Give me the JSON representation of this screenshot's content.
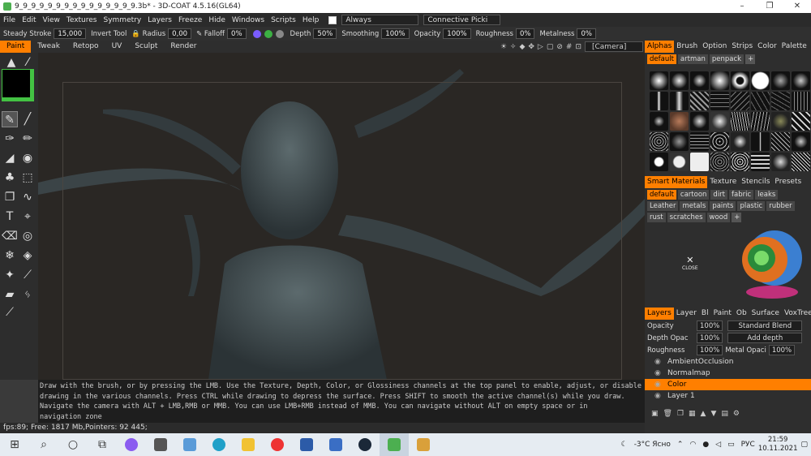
{
  "title": "9_9_9_9_9_9_9_9_9_9_9_9_9_9_9.3b* - 3D-COAT 4.5.16(GL64)",
  "window_controls": {
    "minimize": "–",
    "maximize": "❐",
    "close": "✕"
  },
  "menu": [
    "File",
    "Edit",
    "View",
    "Textures",
    "Symmetry",
    "Layers",
    "Freeze",
    "Hide",
    "Windows",
    "Scripts",
    "Help"
  ],
  "menu_always": "Always",
  "menu_connective": "Connective Picki",
  "toolbar": {
    "steady_label": "Steady",
    "stroke_label": "Stroke",
    "stroke_value": "15,000",
    "invert_label": "Invert",
    "tool_label": "Tool",
    "radius_label": "Radius",
    "radius_value": "0,00",
    "falloff_label": "Falloff",
    "falloff_value": "0%",
    "depth_label": "Depth",
    "depth_value": "50%",
    "smoothing_label": "Smoothing",
    "smoothing_value": "100%",
    "opacity_label": "Opacity",
    "opacity_value": "100%",
    "roughness_label": "Roughness",
    "roughness_value": "0%",
    "metalness_label": "Metalness",
    "metalness_value": "0%"
  },
  "room_tabs": [
    "Paint",
    "Tweak",
    "Retopo",
    "UV",
    "Sculpt",
    "Render"
  ],
  "active_tab": "Paint",
  "camera": "[Camera]",
  "alphas": {
    "tabs": [
      "Alphas",
      "Brush",
      "Option",
      "Strips",
      "Color",
      "Palette"
    ],
    "chips": [
      "default",
      "artman",
      "penpack"
    ]
  },
  "smart_materials": {
    "tabs": [
      "Smart Materials",
      "Texture",
      "Stencils",
      "Presets"
    ],
    "chips": [
      "default",
      "cartoon",
      "dirt",
      "fabric",
      "leaks",
      "Leather",
      "metals",
      "paints",
      "plastic",
      "rubber",
      "rust",
      "scratches",
      "wood"
    ],
    "close_label": "CLOSE"
  },
  "layers_panel": {
    "tabs": [
      "Layers",
      "Layer",
      "Bl",
      "Paint",
      "Ob",
      "Surface",
      "VoxTree"
    ],
    "opacity_label": "Opacity",
    "opacity_value": "100%",
    "blend_mode": "Standard Blend",
    "depth_opacity_label": "Depth Opac",
    "depth_opacity_value": "100%",
    "depth_mode": "Add depth",
    "roughness_label": "Roughness",
    "roughness_value": "100%",
    "metal_opacity_label": "Metal Opaci",
    "metal_opacity_value": "100%",
    "layers": [
      "AmbientOcclusion",
      "Normalmap",
      "Color",
      "Layer 1"
    ],
    "selected": "Color"
  },
  "hint_lines": [
    "Draw with the brush, or by pressing the LMB. Use the Texture, Depth, Color, or Glossiness channels at the top panel to enable, adjust, or disable",
    "drawing in the various channels. Press CTRL while drawing to depress the surface. Press SHIFT to smooth the active channel(s) while you draw.",
    "Navigate the camera with ALT + LMB,RMB or MMB. You can use LMB+RMB instead of MMB. You can navigate without ALT on empty space or in",
    "navigation zone"
  ],
  "status": "fps:89;   Free: 1817 Mb,Pointers: 92 445;",
  "taskbar": {
    "weather": "-3°C Ясно",
    "lang": "РУС",
    "time": "21:59",
    "date": "10.11.2021"
  },
  "colors": {
    "accent": "#ff7f00",
    "swatch_outer": "#43c243",
    "swatch_inner": "#000000"
  }
}
